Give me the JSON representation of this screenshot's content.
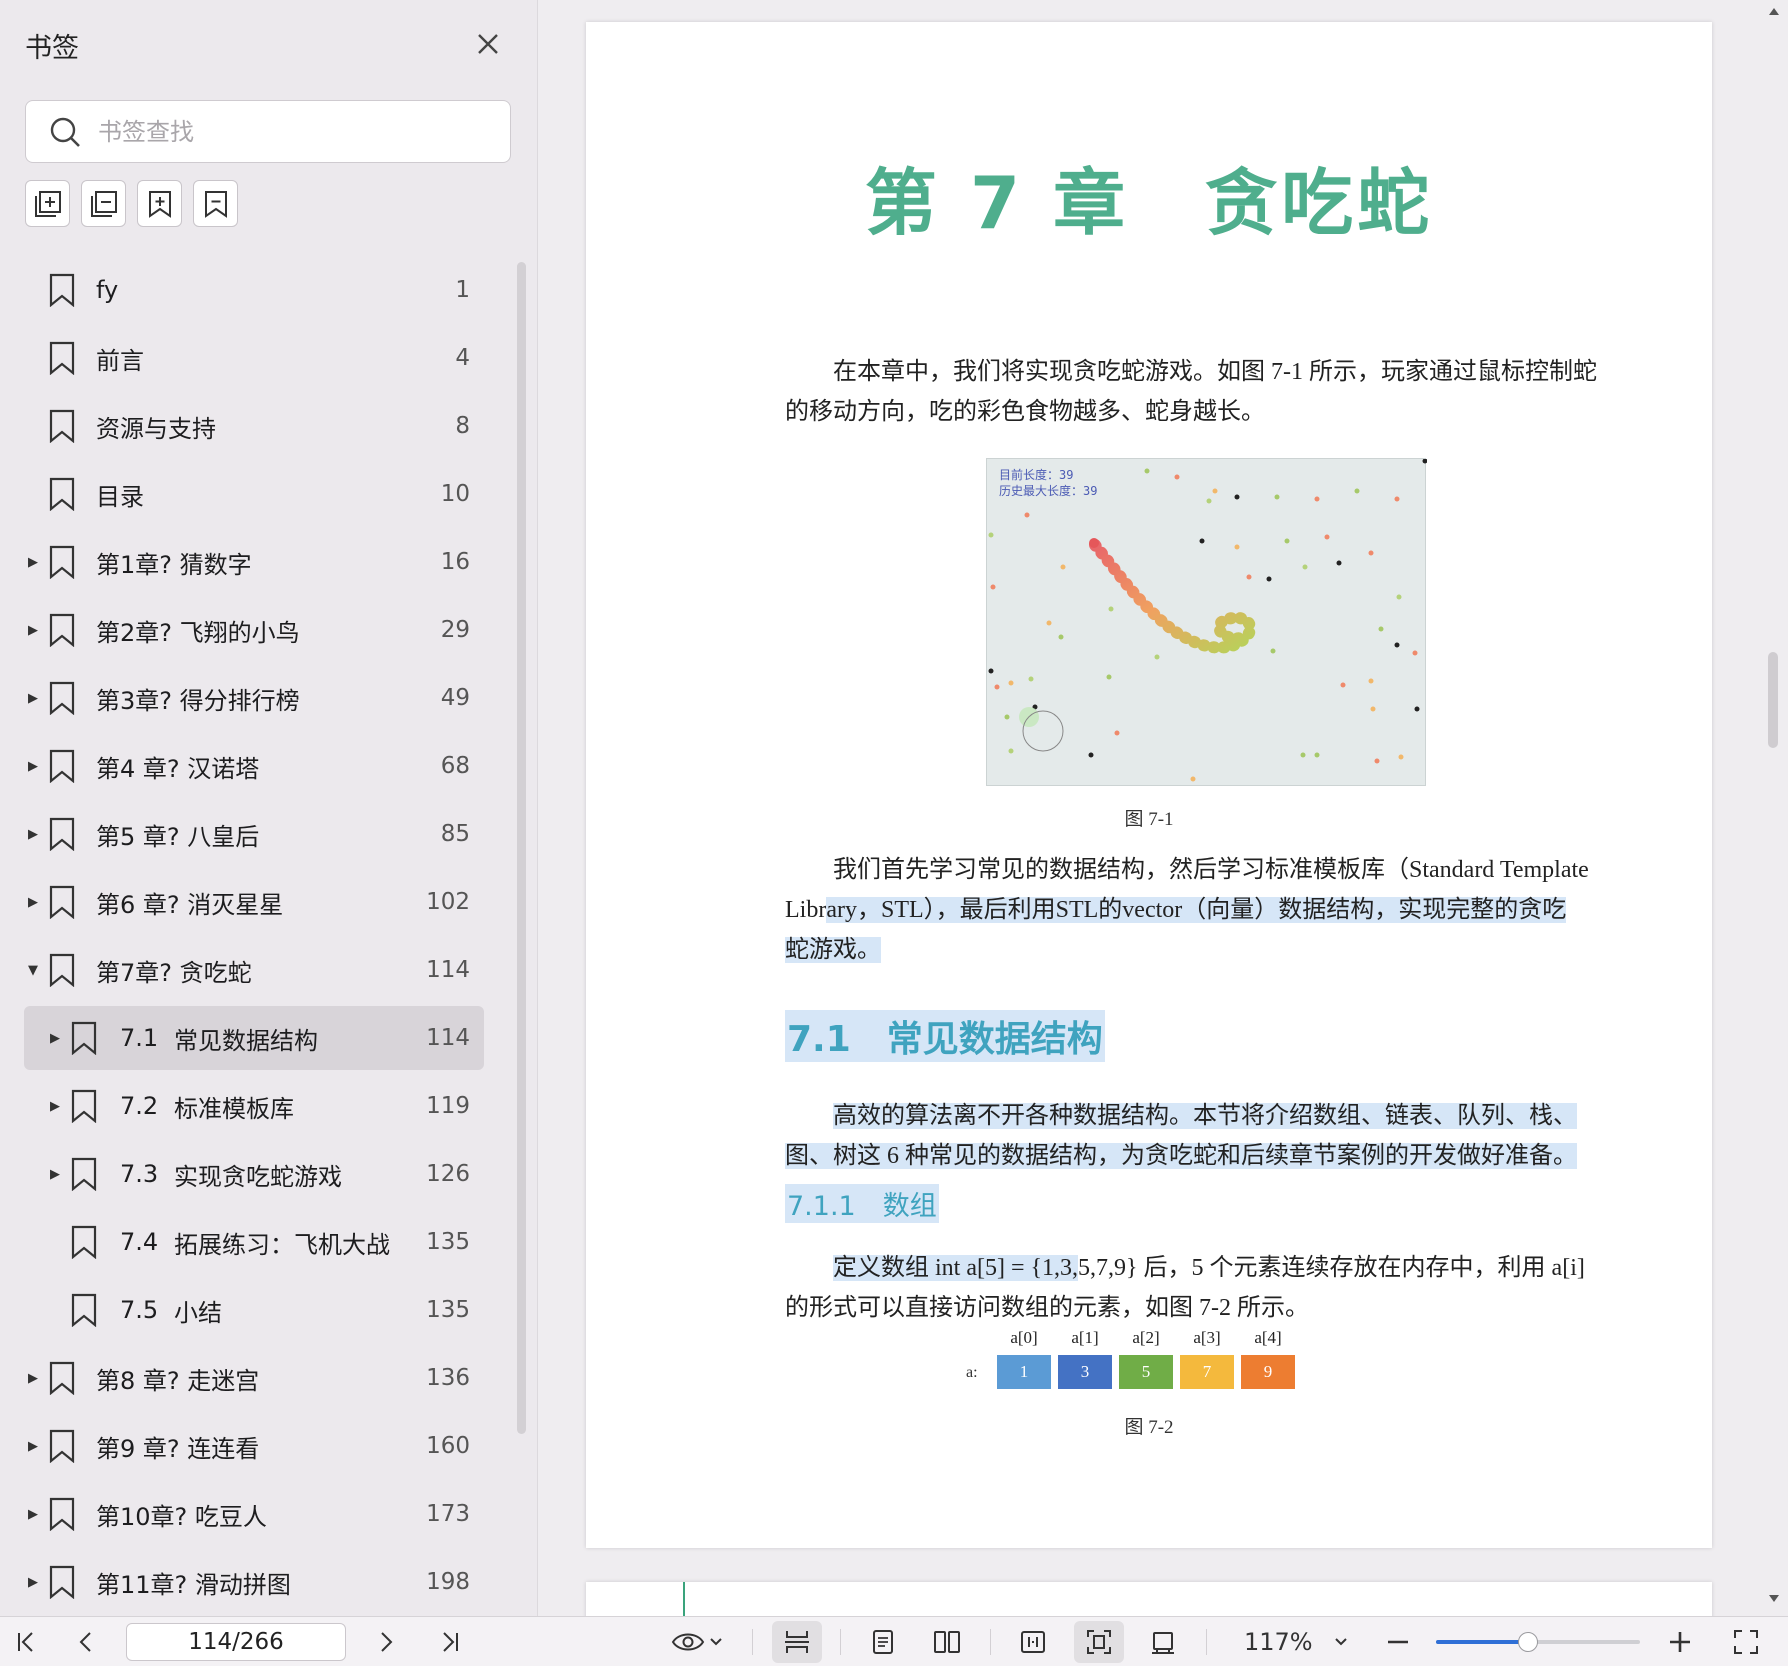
{
  "sidebar": {
    "title": "书签",
    "search_placeholder": "书签查找",
    "bookmarks": [
      {
        "label": "fy",
        "page": "1",
        "level": 1,
        "expander": "none"
      },
      {
        "label": "前言",
        "page": "4",
        "level": 1,
        "expander": "none"
      },
      {
        "label": "资源与支持",
        "page": "8",
        "level": 1,
        "expander": "none"
      },
      {
        "label": "目录",
        "page": "10",
        "level": 1,
        "expander": "none"
      },
      {
        "label": "第1章? 猜数字",
        "page": "16",
        "level": 1,
        "expander": "collapsed"
      },
      {
        "label": "第2章? 飞翔的小鸟",
        "page": "29",
        "level": 1,
        "expander": "collapsed"
      },
      {
        "label": "第3章? 得分排行榜",
        "page": "49",
        "level": 1,
        "expander": "collapsed"
      },
      {
        "label": "第4 章? 汉诺塔",
        "page": "68",
        "level": 1,
        "expander": "collapsed"
      },
      {
        "label": "第5 章? 八皇后",
        "page": "85",
        "level": 1,
        "expander": "collapsed"
      },
      {
        "label": "第6 章? 消灭星星",
        "page": "102",
        "level": 1,
        "expander": "collapsed"
      },
      {
        "label": "第7章? 贪吃蛇",
        "page": "114",
        "level": 1,
        "expander": "expanded"
      },
      {
        "num": "7.1",
        "label": "常见数据结构",
        "page": "114",
        "level": 2,
        "expander": "collapsed",
        "selected": true
      },
      {
        "num": "7.2",
        "label": "标准模板库",
        "page": "119",
        "level": 2,
        "expander": "collapsed"
      },
      {
        "num": "7.3",
        "label": "实现贪吃蛇游戏",
        "page": "126",
        "level": 2,
        "expander": "collapsed"
      },
      {
        "num": "7.4",
        "label": "拓展练习：飞机大战",
        "page": "135",
        "level": 2,
        "expander": "none"
      },
      {
        "num": "7.5",
        "label": "小结",
        "page": "135",
        "level": 2,
        "expander": "none"
      },
      {
        "label": "第8 章? 走迷宫",
        "page": "136",
        "level": 1,
        "expander": "collapsed"
      },
      {
        "label": "第9 章? 连连看",
        "page": "160",
        "level": 1,
        "expander": "collapsed"
      },
      {
        "label": "第10章? 吃豆人",
        "page": "173",
        "level": 1,
        "expander": "collapsed"
      },
      {
        "label": "第11章? 滑动拼图",
        "page": "198",
        "level": 1,
        "expander": "collapsed"
      }
    ]
  },
  "document": {
    "chapter_title": "第 7 章　贪吃蛇",
    "intro_line1": "在本章中，我们将实现贪吃蛇游戏。如图 7-1 所示，玩家通过鼠标控制蛇",
    "intro_line2": "的移动方向，吃的彩色食物越多、蛇身越长。",
    "game_info_line1": "目前长度：39",
    "game_info_line2": "历史最大长度：39",
    "fig1_caption": "图 7-1",
    "p2_line1": "我们首先学习常见的数据结构，然后学习标准模板库（Standard Template",
    "p2_line2_a": "Libr",
    "p2_line2_b": "ary，STL），最后利用STL的vector（向量）数据结构，实现完整的贪吃",
    "p2_line3": "蛇游戏。",
    "section_title": "7.1　常见数据结构",
    "p3_line1": "高效的算法离不开各种数据结构。本节将介绍数组、链表、队列、栈、",
    "p3_line2": "图、树这 6 种常见的数据结构，为贪吃蛇和后续章节案例的开发做好准备。",
    "subsection_title": "7.1.1　数组",
    "p4_line1_a": "定义数组 int a[5] = {1,3,",
    "p4_line1_b": "5,7,9} 后，5 个元素连续存放在内存中，利用 a[i]",
    "p4_line2": "的形式可以直接访问数组的元素，如图 7-2 所示。",
    "array_var": "a:",
    "array_labels": [
      "a[0]",
      "a[1]",
      "a[2]",
      "a[3]",
      "a[4]"
    ],
    "array_values": [
      "1",
      "3",
      "5",
      "7",
      "9"
    ],
    "array_colors": [
      "#5b9bd5",
      "#4472c4",
      "#70ad47",
      "#f4b93d",
      "#ed7d31"
    ],
    "fig2_caption": "图 7-2"
  },
  "toolbar": {
    "page_indicator": "114/266",
    "zoom": "117%",
    "zoom_fraction": 0.45
  },
  "colors": {
    "accent_green": "#4fae8d",
    "heading_blue": "#3fa3bf",
    "highlight": "#d6e6f7",
    "selection": "#d8d4d9"
  }
}
